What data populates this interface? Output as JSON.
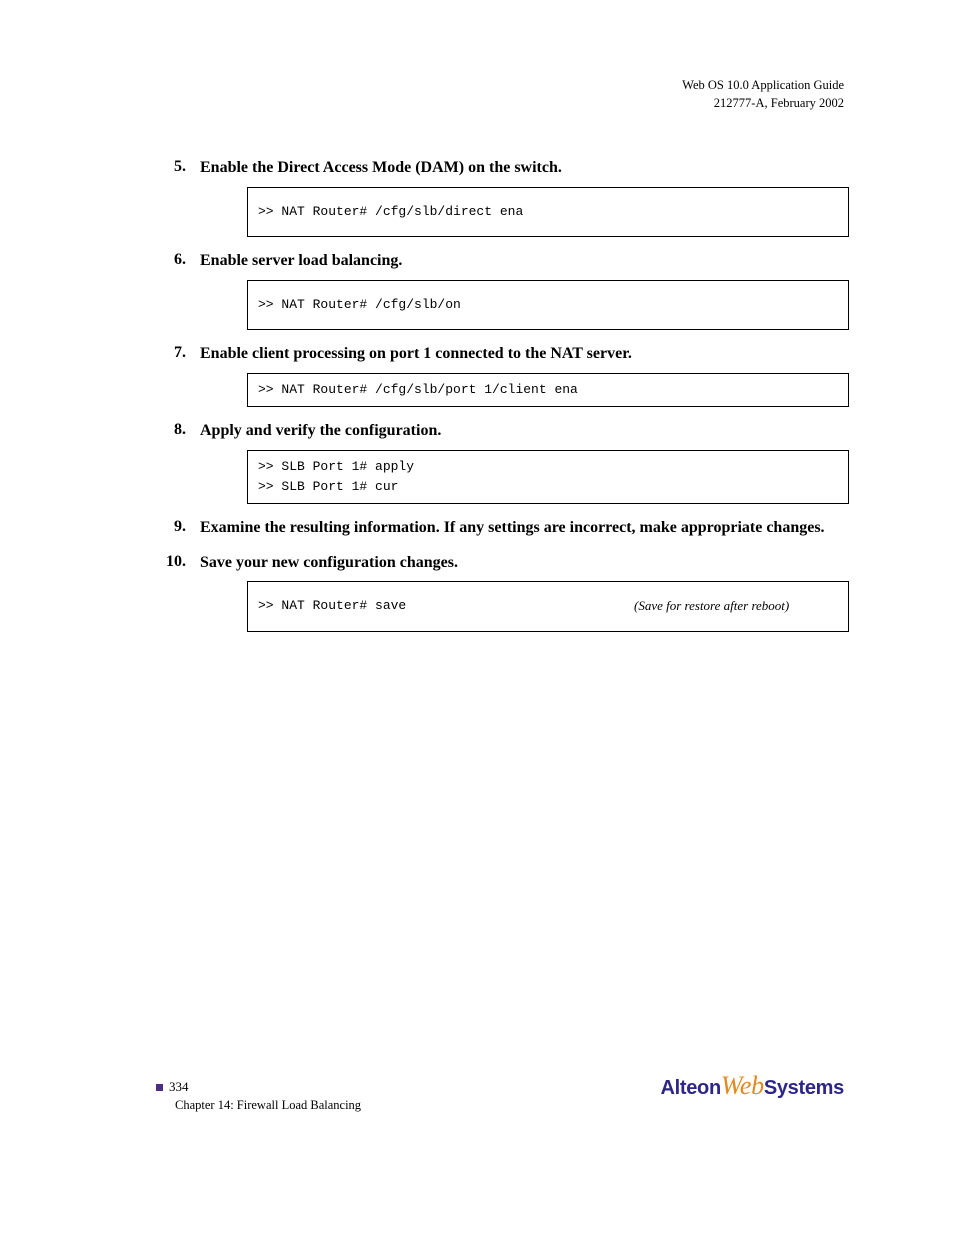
{
  "header": {
    "line1": "Web OS 10.0 Application Guide",
    "line2": "212777-A, February 2002"
  },
  "step5": {
    "num": "5.",
    "text": "Enable the Direct Access Mode (DAM) on the switch.",
    "commands": [
      {
        "cmd": ">> NAT Router# /cfg/slb/direct ena"
      }
    ]
  },
  "step6": {
    "num": "6.",
    "text": "Enable server load balancing.",
    "commands": [
      {
        "cmd": ">> NAT Router# /cfg/slb/on"
      }
    ]
  },
  "step7": {
    "num": "7.",
    "text": "Enable client processing on port 1 connected to the NAT server.",
    "commands": [
      {
        "cmd": ">> NAT Router# /cfg/slb/port 1/client ena"
      }
    ]
  },
  "step8": {
    "num": "8.",
    "text": "Apply and verify the configuration.",
    "commands": [
      {
        "cmd": ">> SLB Port 1# apply"
      },
      {
        "cmd": ">> SLB Port 1# cur"
      }
    ]
  },
  "step9": {
    "num": "9.",
    "text": "Examine the resulting information. If any settings are incorrect, make appropriate changes.",
    "commands": []
  },
  "step10": {
    "num": "10.",
    "text": "Save your new configuration changes.",
    "commands": [
      {
        "cmd": ">> NAT Router# save",
        "cmt": "(Save for restore after reboot)",
        "cmdWidth": "376px"
      }
    ]
  },
  "footer": {
    "pageNumber": "334",
    "chapter": "Chapter 14: Firewall Load Balancing"
  },
  "logo": {
    "alteon": "Alteon",
    "web": "Web",
    "systems": "Systems"
  }
}
